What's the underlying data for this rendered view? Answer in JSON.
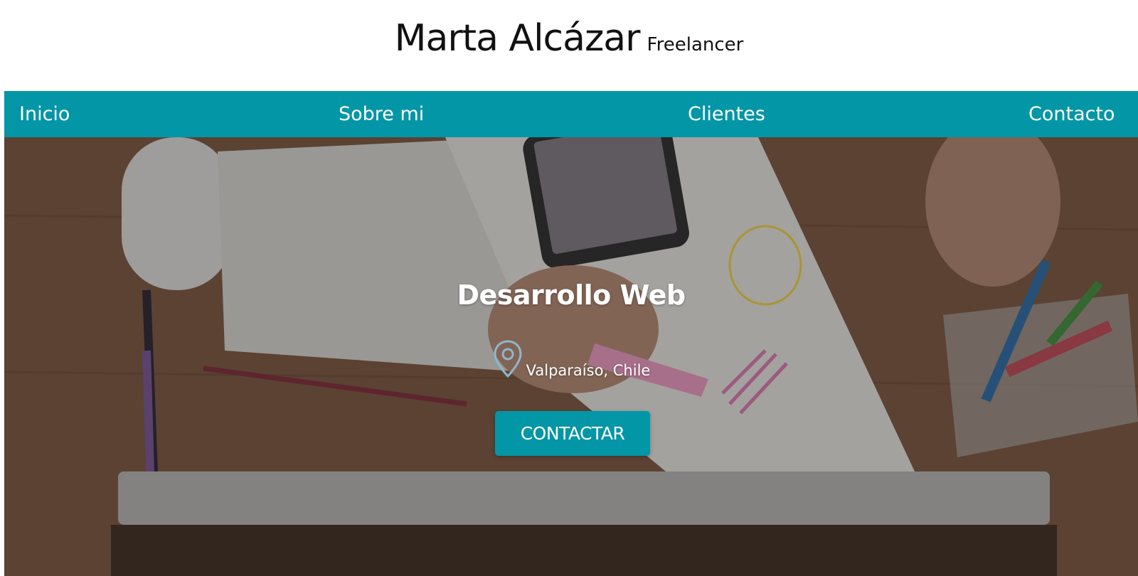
{
  "header": {
    "name": "Marta Alcázar",
    "tagline": "Freelancer"
  },
  "nav": {
    "items": [
      "Inicio",
      "Sobre mi",
      "Clientes",
      "Contacto"
    ]
  },
  "hero": {
    "title": "Desarrollo Web",
    "location": "Valparaíso, Chile",
    "location_icon": "map-pin-icon",
    "cta_label": "CONTACTAR"
  },
  "colors": {
    "accent": "#0396a6",
    "pin": "#8fb7cc",
    "header_bg": "#ffffff",
    "text_dark": "#111111"
  }
}
